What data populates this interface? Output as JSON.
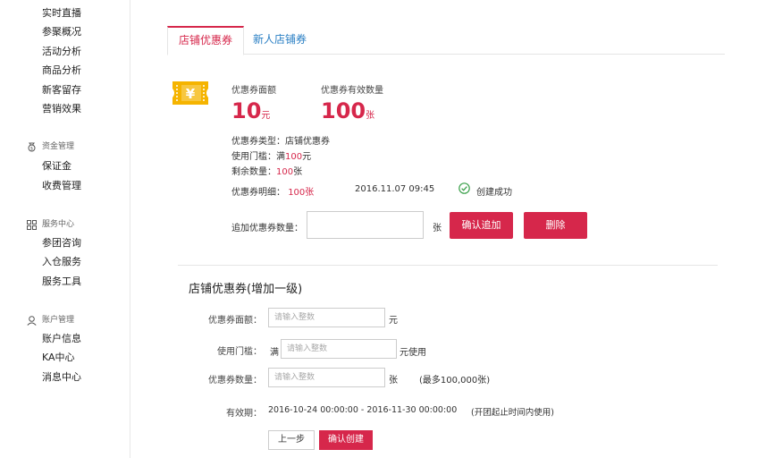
{
  "sidebar": {
    "top_items": [
      "实时直播",
      "参聚概况",
      "活动分析",
      "商品分析",
      "新客留存",
      "营销效果"
    ],
    "groups": [
      {
        "title": "资金管理",
        "icon": "money-bag-icon",
        "items": [
          "保证金",
          "收费管理"
        ]
      },
      {
        "title": "服务中心",
        "icon": "grid-icon",
        "items": [
          "参团咨询",
          "入仓服务",
          "服务工具"
        ]
      },
      {
        "title": "账户管理",
        "icon": "user-icon",
        "items": [
          "账户信息",
          "KA中心",
          "消息中心"
        ]
      }
    ]
  },
  "tabs": [
    {
      "label": "店铺优惠券",
      "active": true
    },
    {
      "label": "新人店铺券",
      "active": false
    }
  ],
  "coupon": {
    "icon": "coupon-ticket-icon",
    "amount_label": "优惠券面额",
    "amount_value": "10",
    "amount_unit": "元",
    "count_label": "优惠券有效数量",
    "count_value": "100",
    "count_unit": "张",
    "type_label": "优惠券类型：",
    "type_value": "店铺优惠券",
    "threshold_label": "使用门槛：",
    "threshold_prefix": "满",
    "threshold_value": "100",
    "threshold_unit": "元",
    "remain_label": "剩余数量：",
    "remain_value": "100",
    "remain_unit": "张",
    "detail_label": "优惠券明细：",
    "detail_value": "100张",
    "detail_time": "2016.11.07 09:45",
    "detail_status": "创建成功",
    "add_label": "追加优惠券数量：",
    "add_value": "",
    "add_unit": "张",
    "confirm_add_button": "确认追加",
    "delete_button": "删除"
  },
  "form": {
    "title": "店铺优惠券(增加一级)",
    "amount_label": "优惠券面额：",
    "amount_placeholder": "请输入整数",
    "amount_unit": "元",
    "threshold_label": "使用门槛：",
    "threshold_prefix": "满",
    "threshold_placeholder": "请输入整数",
    "threshold_unit": "元使用",
    "count_label": "优惠券数量：",
    "count_placeholder": "请输入整数",
    "count_unit": "张",
    "count_hint": "(最多100,000张)",
    "validity_label": "有效期：",
    "validity_value": "2016-10-24 00:00:00 - 2016-11-30 00:00:00",
    "validity_hint": "(开团起止时间内使用)",
    "prev_button": "上一步",
    "create_button": "确认创建"
  },
  "colors": {
    "accent": "#d6274b",
    "link": "#2a7fc4",
    "success": "#3aa04a",
    "icon": "#f5b400"
  }
}
